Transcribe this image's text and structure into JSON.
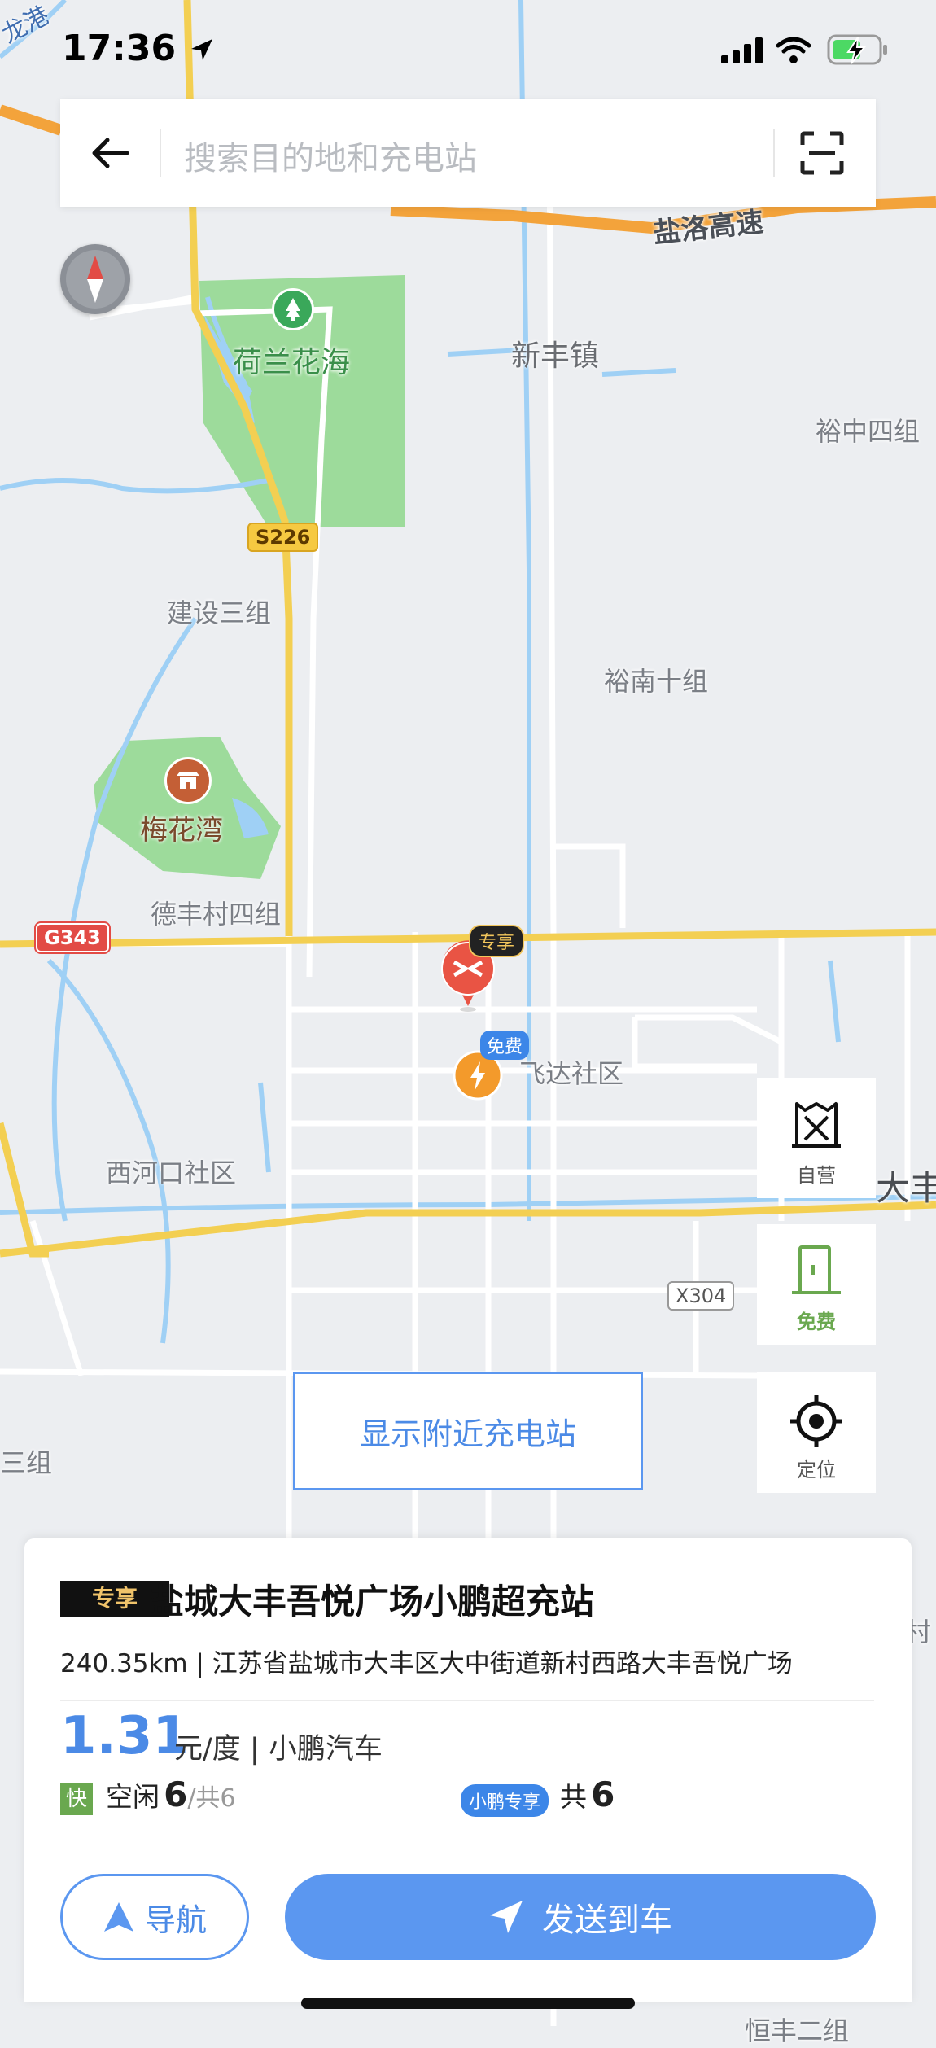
{
  "status_bar": {
    "time": "17:36"
  },
  "search": {
    "placeholder": "搜索目的地和充电站"
  },
  "map_labels": {
    "longgang": "龙港",
    "yanluo_highway": "盐洛高速",
    "xinfeng_town": "新丰镇",
    "helan_huahai": "荷兰花海",
    "yuzhong_4": "裕中四组",
    "s226": "S226",
    "jianshe_3": "建设三组",
    "yunan_10": "裕南十组",
    "meihuawan": "梅花湾",
    "defengcun_4": "德丰村四组",
    "g343": "G343",
    "feida_shequ": "飞达社区",
    "xihekou_shequ": "西河口社区",
    "dafeng": "大丰",
    "x304": "X304",
    "left_zu": "三组",
    "right_cun": "村",
    "bottom_partial": "恒丰二组"
  },
  "pins": {
    "exclusive_tag": "专享",
    "free_tag": "免费"
  },
  "controls": {
    "self_operated": "自营",
    "free": "免费",
    "locate": "定位",
    "show_nearby": "显示附近充电站"
  },
  "station": {
    "badge": "专享",
    "name": "盐城大丰吾悦广场小鹏超充站",
    "distance_address": "240.35km | 江苏省盐城市大丰区大中街道新村西路大丰吾悦广场",
    "price": "1.31",
    "price_unit": "元/度 | 小鹏汽车",
    "fast_icon": "快",
    "idle_label": "空闲",
    "idle_count": "6",
    "total_sep": "/共6",
    "xpeng_badge": "小鹏专享",
    "total_label": "共",
    "total_count": "6"
  },
  "actions": {
    "navigate": "导航",
    "send_to_car": "发送到车"
  },
  "colors": {
    "accent": "#5b97f0",
    "green": "#6aa84f",
    "road_yellow": "#f3cf52",
    "highway_orange": "#f3a33b",
    "water": "#9fd0f5",
    "park": "#9ddb9b"
  }
}
